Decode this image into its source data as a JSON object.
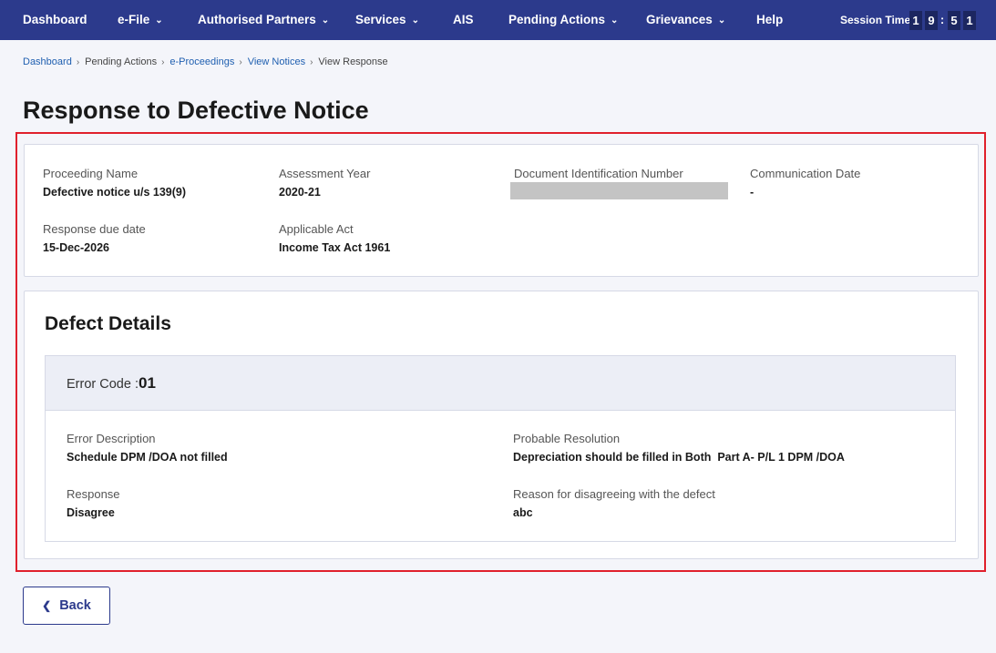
{
  "nav": {
    "items": [
      {
        "label": "Dashboard",
        "has_menu": false
      },
      {
        "label": "e-File",
        "has_menu": true
      },
      {
        "label": "Authorised Partners",
        "has_menu": true
      },
      {
        "label": "Services",
        "has_menu": true
      },
      {
        "label": "AIS",
        "has_menu": false
      },
      {
        "label": "Pending Actions",
        "has_menu": true
      },
      {
        "label": "Grievances",
        "has_menu": true
      },
      {
        "label": "Help",
        "has_menu": false
      }
    ],
    "session_label": "Session Time",
    "session_digits": [
      "1",
      "9",
      "5",
      "1"
    ],
    "colon": ":"
  },
  "breadcrumb": [
    {
      "label": "Dashboard",
      "link": true
    },
    {
      "label": "Pending Actions",
      "link": false
    },
    {
      "label": "e-Proceedings",
      "link": true
    },
    {
      "label": "View Notices",
      "link": true
    },
    {
      "label": "View Response",
      "link": false
    }
  ],
  "page_title": "Response to Defective Notice",
  "summary": {
    "proceeding_name": {
      "label": "Proceeding Name",
      "value": "Defective notice u/s 139(9)"
    },
    "assessment_year": {
      "label": "Assessment Year",
      "value": "2020-21"
    },
    "din": {
      "label": "Document Identification Number",
      "value": ""
    },
    "communication_date": {
      "label": "Communication Date",
      "value": "-"
    },
    "response_due_date": {
      "label": "Response due date",
      "value": "15-Dec-2026"
    },
    "applicable_act": {
      "label": "Applicable Act",
      "value": "Income Tax Act 1961"
    }
  },
  "defect": {
    "section_title": "Defect Details",
    "error_code_label": "Error Code :",
    "error_code": "01",
    "error_description": {
      "label": "Error Description",
      "value": "Schedule DPM /DOA not filled"
    },
    "probable_resolution": {
      "label": "Probable Resolution",
      "value": "Depreciation should be filled in Both  Part A- P/L 1 DPM /DOA"
    },
    "response": {
      "label": "Response",
      "value": "Disagree"
    },
    "reason": {
      "label": "Reason for disagreeing with the defect",
      "value": "abc"
    }
  },
  "back_button": "Back",
  "colors": {
    "nav_bg": "#2c3a8c",
    "highlight": "#e0202c",
    "link": "#1f5fb0"
  }
}
